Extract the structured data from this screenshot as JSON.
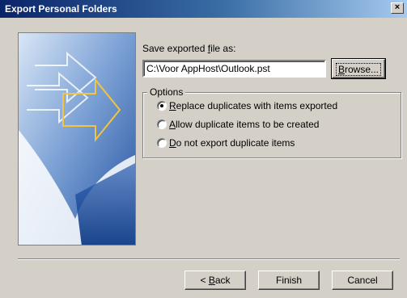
{
  "window": {
    "title": "Export Personal Folders",
    "close_glyph": "×"
  },
  "banner": {
    "icon": "export-wizard-arrows-graphic"
  },
  "file_section": {
    "label_pre": "Save exported ",
    "label_accel": "f",
    "label_post": "ile as:",
    "path_value": "C:\\Voor AppHost\\Outlook.pst",
    "browse_accel": "B",
    "browse_rest": "rowse..."
  },
  "options": {
    "legend": "Options",
    "items": [
      {
        "accel": "R",
        "rest": "eplace duplicates with items exported",
        "checked": true
      },
      {
        "accel": "A",
        "rest": "llow duplicate items to be created",
        "checked": false
      },
      {
        "accel": "D",
        "rest": "o not export duplicate items",
        "checked": false
      }
    ]
  },
  "footer": {
    "back_pre": "< ",
    "back_accel": "B",
    "back_rest": "ack",
    "finish_label": "Finish",
    "cancel_label": "Cancel"
  },
  "colors": {
    "titlebar_start": "#0a246a",
    "titlebar_end": "#a6caf0",
    "dialog_face": "#d4d0c8"
  }
}
